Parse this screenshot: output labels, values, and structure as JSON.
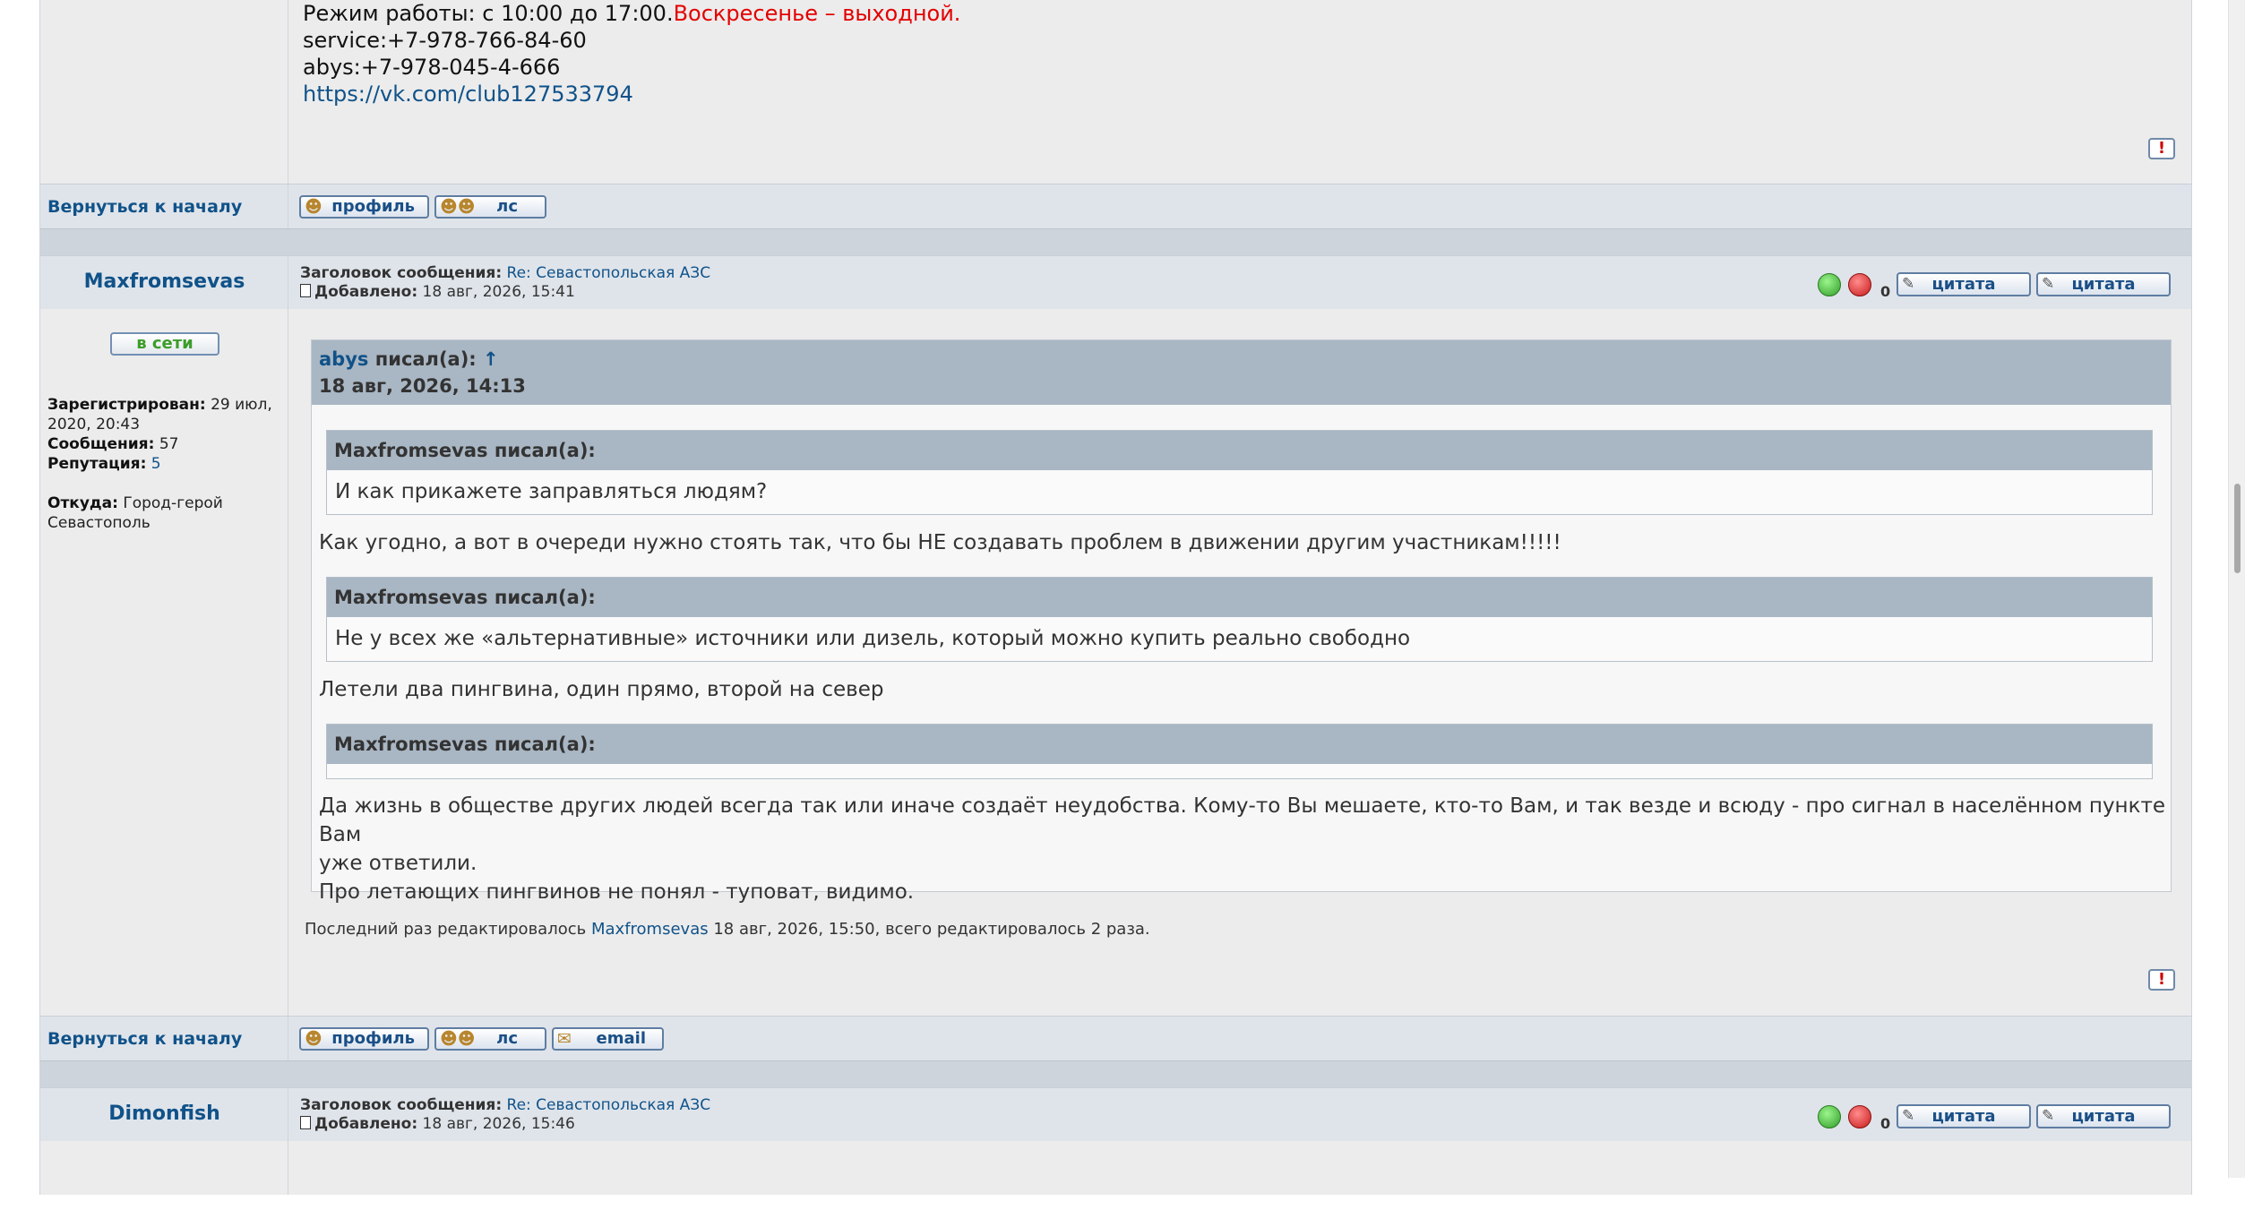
{
  "post1": {
    "sig_line0_prefix": "Режим работы: с 10:00 до 17:00.",
    "sig_line0_red": "Воскресенье – выходной.",
    "sig_line1": "service:+7-978-766-84-60",
    "sig_line2": "abys:+7-978-045-4-666",
    "sig_link": "https://vk.com/club127533794",
    "report_icon": "!"
  },
  "actions1": {
    "back": "Вернуться к началу",
    "profile": "профиль",
    "pm": "лс"
  },
  "post2": {
    "username": "Maxfromsevas",
    "subject_label": "Заголовок сообщения:",
    "subject": "Re: Севастопольская АЗС",
    "posted_label": "Добавлено:",
    "posted": "18 авг, 2026, 15:41",
    "rating": "0",
    "quote_label": "цитата",
    "quote2_label": "цитата",
    "online": "в сети",
    "reg_label": "Зарегистрирован:",
    "reg_value": "29 июл, 2020, 20:43",
    "posts_label": "Сообщения:",
    "posts_value": "57",
    "rep_label": "Репутация:",
    "rep_value": "5",
    "from_label": "Откуда:",
    "from_value": "Город-герой Севастополь",
    "outer_quote": {
      "author": "abys",
      "wrote": "писал(а):",
      "arrow": "↑",
      "date": "18 авг, 2026, 14:13"
    },
    "inner_quotes": [
      {
        "head": "Maxfromsevas писал(а):",
        "text": "И как прикажете заправляться людям?"
      },
      {
        "head": "Maxfromsevas писал(а):",
        "text": "Не у всех же «альтернативные» источники или дизель, который можно купить реально свободно"
      },
      {
        "head": "Maxfromsevas писал(а):",
        "text": ""
      }
    ],
    "replies": [
      "Как угодно, а вот в очереди нужно стоять так, что бы НЕ создавать проблем в движении другим участникам!!!!!",
      "Летели два пингвина, один прямо, второй на север"
    ],
    "final_line1": "Да жизнь в обществе других людей всегда так или иначе создаёт неудобства. Кому-то Вы мешаете, кто-то Вам, и так везде и всюду - про сигнал в населённом пункте Вам",
    "final_line2": "уже ответили.",
    "final_line3": "Про летающих пингвинов не понял - туповат, видимо.",
    "edit_prefix": "Последний раз редактировалось",
    "edit_user": "Maxfromsevas",
    "edit_suffix": "18 авг, 2026, 15:50, всего редактировалось 2 раза."
  },
  "actions2": {
    "back": "Вернуться к началу",
    "profile": "профиль",
    "pm": "лс",
    "email": "email"
  },
  "post3": {
    "username": "Dimonfish",
    "subject_label": "Заголовок сообщения:",
    "subject": "Re: Севастопольская АЗС",
    "posted_label": "Добавлено:",
    "posted": "18 авг, 2026, 15:46",
    "rating": "0",
    "quote_label": "цитата",
    "quote2_label": "цитата"
  },
  "colors": {
    "link": "#105289",
    "red": "#e30000",
    "quote_header": "#a9b6c3",
    "post_bg": "#ececec",
    "row_bg": "#dfe4ea"
  }
}
